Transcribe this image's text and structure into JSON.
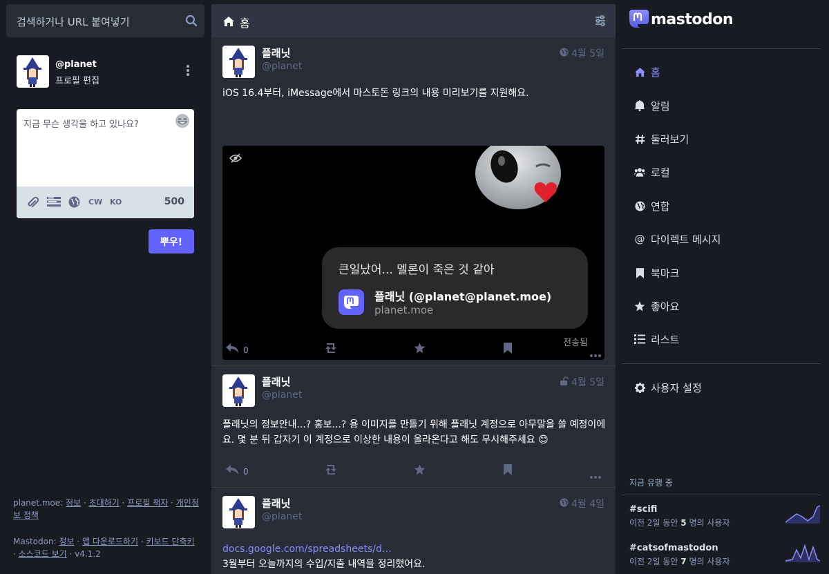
{
  "search": {
    "placeholder": "검색하거나 URL 붙여넣기"
  },
  "profile": {
    "handle": "@planet",
    "edit_label": "프로필 편집"
  },
  "compose": {
    "placeholder": "지금 무슨 생각을 하고 있나요?",
    "cw_label": "CW",
    "lang_label": "KO",
    "char_count": "500",
    "submit_label": "뿌우!"
  },
  "footer": {
    "site": "planet.moe",
    "site_links": [
      "정보",
      "초대하기",
      "프로필 책자",
      "개인정보 정책"
    ],
    "app": "Mastodon",
    "app_links": [
      "정보",
      "앱 다운로드하기",
      "키보드 단축키",
      "소스코드 보기"
    ],
    "version": "v4.1.2"
  },
  "column": {
    "title": "홈"
  },
  "statuses": [
    {
      "display_name": "플래닛",
      "acct": "@planet",
      "date": "4월 5일",
      "visibility": "globe-icon",
      "content": "iOS 16.4부터, iMessage에서 마스토돈 링크의 내용 미리보기를 지원해요.",
      "media": {
        "message": "큰일났어... 멜론이 죽은 것 같아",
        "preview_title": "플래닛 (@planet@planet.moe)",
        "preview_domain": "planet.moe",
        "delivered": "전송됨"
      },
      "replies": "0"
    },
    {
      "display_name": "플래닛",
      "acct": "@planet",
      "date": "4월 5일",
      "visibility": "unlock-icon",
      "content": "플래닛의 정보안내...? 홍보...? 용 이미지를 만들기 위해 플래닛 계정으로 아무말을 쓸 예정이에요. 몇 분 뒤 갑자기 이 계정으로 이상한 내용이 올라온다고 해도 무시해주세요 😊",
      "replies": "0"
    },
    {
      "display_name": "플래닛",
      "acct": "@planet",
      "date": "4월 4일",
      "visibility": "globe-icon",
      "link": "docs.google.com/spreadsheets/d…",
      "content": "3월부터 오늘까지의 수입/지출 내역을 정리했어요."
    }
  ],
  "brand": {
    "name": "mastodon",
    "accent": "#6364ff",
    "link": "#8c8dff"
  },
  "nav": [
    {
      "label": "홈",
      "icon": "home-icon",
      "active": true
    },
    {
      "label": "알림",
      "icon": "bell-icon"
    },
    {
      "label": "둘러보기",
      "icon": "hashtag-icon"
    },
    {
      "label": "로컬",
      "icon": "users-icon"
    },
    {
      "label": "연합",
      "icon": "globe-icon"
    },
    {
      "label": "다이렉트 메시지",
      "icon": "at-icon"
    },
    {
      "label": "북마크",
      "icon": "bookmark-icon"
    },
    {
      "label": "좋아요",
      "icon": "star-icon"
    },
    {
      "label": "리스트",
      "icon": "list-icon"
    }
  ],
  "settings": {
    "label": "사용자 설정"
  },
  "trends": {
    "heading": "지금 유행 중",
    "items": [
      {
        "tag": "#scifi",
        "prefix": "이전 2일 동안",
        "count": "5",
        "suffix": "명의 사용자"
      },
      {
        "tag": "#catsofmastodon",
        "prefix": "이전 2일 동안",
        "count": "7",
        "suffix": "명의 사용자"
      }
    ]
  }
}
